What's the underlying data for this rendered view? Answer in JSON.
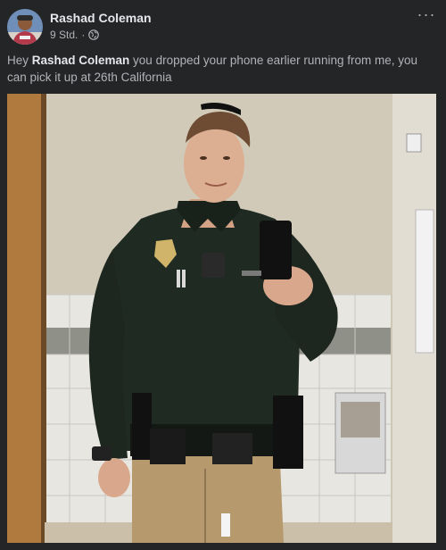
{
  "post": {
    "author": "Rashad Coleman",
    "time": "9 Std.",
    "separator": "·",
    "audience_icon": "globe-icon",
    "more_icon": "more-horizontal-icon",
    "more_label": "···",
    "text_before": "Hey ",
    "mention": "Rashad Coleman",
    "text_after": " you dropped your phone earlier running from me, you can pick it up at 26th California"
  },
  "colors": {
    "background": "#242526",
    "primary_text": "#e4e6eb",
    "secondary_text": "#b0b3b8"
  }
}
